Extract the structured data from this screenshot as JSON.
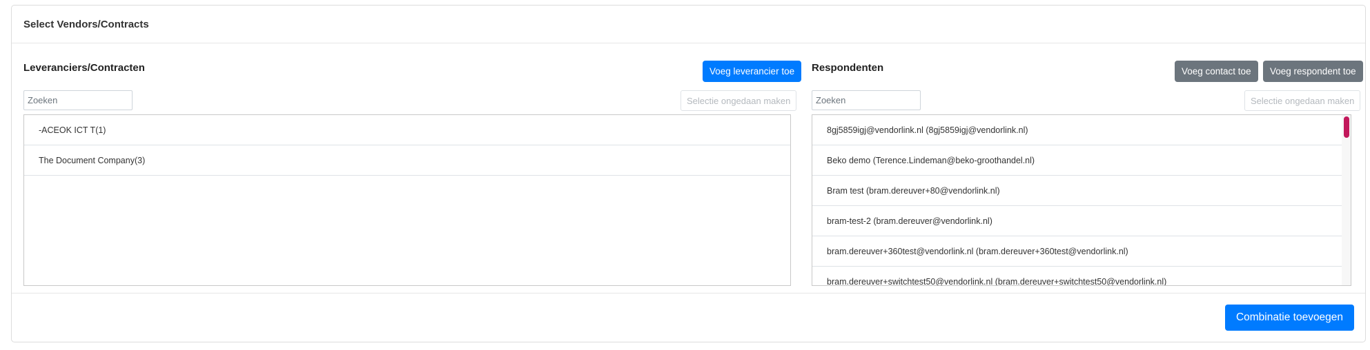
{
  "card": {
    "title": "Select Vendors/Contracts"
  },
  "vendors": {
    "title": "Leveranciers/Contracten",
    "add_button": "Voeg leverancier toe",
    "search_placeholder": "Zoeken",
    "clear_button": "Selectie ongedaan maken",
    "items": [
      "-ACEOK ICT T(1)",
      "The Document Company(3)"
    ]
  },
  "respondents": {
    "title": "Respondenten",
    "add_contact_button": "Voeg contact toe",
    "add_respondent_button": "Voeg respondent toe",
    "search_placeholder": "Zoeken",
    "clear_button": "Selectie ongedaan maken",
    "items": [
      "8gj5859igj@vendorlink.nl (8gj5859igj@vendorlink.nl)",
      "Beko demo (Terence.Lindeman@beko-groothandel.nl)",
      "Bram test (bram.dereuver+80@vendorlink.nl)",
      "bram-test-2 (bram.dereuver@vendorlink.nl)",
      "bram.dereuver+360test@vendorlink.nl (bram.dereuver+360test@vendorlink.nl)",
      "bram.dereuver+switchtest50@vendorlink.nl (bram.dereuver+switchtest50@vendorlink.nl)"
    ]
  },
  "footer": {
    "submit_button": "Combinatie toevoegen"
  },
  "colors": {
    "primary": "#007bff",
    "secondary": "#6c757d",
    "scrollbar_thumb": "#c2185b"
  }
}
